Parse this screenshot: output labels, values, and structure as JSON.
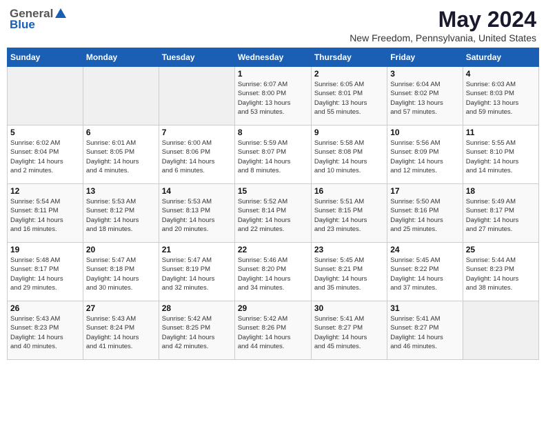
{
  "header": {
    "logo": {
      "general": "General",
      "blue": "Blue"
    },
    "title": "May 2024",
    "location": "New Freedom, Pennsylvania, United States"
  },
  "weekdays": [
    "Sunday",
    "Monday",
    "Tuesday",
    "Wednesday",
    "Thursday",
    "Friday",
    "Saturday"
  ],
  "weeks": [
    [
      {
        "day": "",
        "info": ""
      },
      {
        "day": "",
        "info": ""
      },
      {
        "day": "",
        "info": ""
      },
      {
        "day": "1",
        "info": "Sunrise: 6:07 AM\nSunset: 8:00 PM\nDaylight: 13 hours\nand 53 minutes."
      },
      {
        "day": "2",
        "info": "Sunrise: 6:05 AM\nSunset: 8:01 PM\nDaylight: 13 hours\nand 55 minutes."
      },
      {
        "day": "3",
        "info": "Sunrise: 6:04 AM\nSunset: 8:02 PM\nDaylight: 13 hours\nand 57 minutes."
      },
      {
        "day": "4",
        "info": "Sunrise: 6:03 AM\nSunset: 8:03 PM\nDaylight: 13 hours\nand 59 minutes."
      }
    ],
    [
      {
        "day": "5",
        "info": "Sunrise: 6:02 AM\nSunset: 8:04 PM\nDaylight: 14 hours\nand 2 minutes."
      },
      {
        "day": "6",
        "info": "Sunrise: 6:01 AM\nSunset: 8:05 PM\nDaylight: 14 hours\nand 4 minutes."
      },
      {
        "day": "7",
        "info": "Sunrise: 6:00 AM\nSunset: 8:06 PM\nDaylight: 14 hours\nand 6 minutes."
      },
      {
        "day": "8",
        "info": "Sunrise: 5:59 AM\nSunset: 8:07 PM\nDaylight: 14 hours\nand 8 minutes."
      },
      {
        "day": "9",
        "info": "Sunrise: 5:58 AM\nSunset: 8:08 PM\nDaylight: 14 hours\nand 10 minutes."
      },
      {
        "day": "10",
        "info": "Sunrise: 5:56 AM\nSunset: 8:09 PM\nDaylight: 14 hours\nand 12 minutes."
      },
      {
        "day": "11",
        "info": "Sunrise: 5:55 AM\nSunset: 8:10 PM\nDaylight: 14 hours\nand 14 minutes."
      }
    ],
    [
      {
        "day": "12",
        "info": "Sunrise: 5:54 AM\nSunset: 8:11 PM\nDaylight: 14 hours\nand 16 minutes."
      },
      {
        "day": "13",
        "info": "Sunrise: 5:53 AM\nSunset: 8:12 PM\nDaylight: 14 hours\nand 18 minutes."
      },
      {
        "day": "14",
        "info": "Sunrise: 5:53 AM\nSunset: 8:13 PM\nDaylight: 14 hours\nand 20 minutes."
      },
      {
        "day": "15",
        "info": "Sunrise: 5:52 AM\nSunset: 8:14 PM\nDaylight: 14 hours\nand 22 minutes."
      },
      {
        "day": "16",
        "info": "Sunrise: 5:51 AM\nSunset: 8:15 PM\nDaylight: 14 hours\nand 23 minutes."
      },
      {
        "day": "17",
        "info": "Sunrise: 5:50 AM\nSunset: 8:16 PM\nDaylight: 14 hours\nand 25 minutes."
      },
      {
        "day": "18",
        "info": "Sunrise: 5:49 AM\nSunset: 8:17 PM\nDaylight: 14 hours\nand 27 minutes."
      }
    ],
    [
      {
        "day": "19",
        "info": "Sunrise: 5:48 AM\nSunset: 8:17 PM\nDaylight: 14 hours\nand 29 minutes."
      },
      {
        "day": "20",
        "info": "Sunrise: 5:47 AM\nSunset: 8:18 PM\nDaylight: 14 hours\nand 30 minutes."
      },
      {
        "day": "21",
        "info": "Sunrise: 5:47 AM\nSunset: 8:19 PM\nDaylight: 14 hours\nand 32 minutes."
      },
      {
        "day": "22",
        "info": "Sunrise: 5:46 AM\nSunset: 8:20 PM\nDaylight: 14 hours\nand 34 minutes."
      },
      {
        "day": "23",
        "info": "Sunrise: 5:45 AM\nSunset: 8:21 PM\nDaylight: 14 hours\nand 35 minutes."
      },
      {
        "day": "24",
        "info": "Sunrise: 5:45 AM\nSunset: 8:22 PM\nDaylight: 14 hours\nand 37 minutes."
      },
      {
        "day": "25",
        "info": "Sunrise: 5:44 AM\nSunset: 8:23 PM\nDaylight: 14 hours\nand 38 minutes."
      }
    ],
    [
      {
        "day": "26",
        "info": "Sunrise: 5:43 AM\nSunset: 8:23 PM\nDaylight: 14 hours\nand 40 minutes."
      },
      {
        "day": "27",
        "info": "Sunrise: 5:43 AM\nSunset: 8:24 PM\nDaylight: 14 hours\nand 41 minutes."
      },
      {
        "day": "28",
        "info": "Sunrise: 5:42 AM\nSunset: 8:25 PM\nDaylight: 14 hours\nand 42 minutes."
      },
      {
        "day": "29",
        "info": "Sunrise: 5:42 AM\nSunset: 8:26 PM\nDaylight: 14 hours\nand 44 minutes."
      },
      {
        "day": "30",
        "info": "Sunrise: 5:41 AM\nSunset: 8:27 PM\nDaylight: 14 hours\nand 45 minutes."
      },
      {
        "day": "31",
        "info": "Sunrise: 5:41 AM\nSunset: 8:27 PM\nDaylight: 14 hours\nand 46 minutes."
      },
      {
        "day": "",
        "info": ""
      }
    ]
  ]
}
